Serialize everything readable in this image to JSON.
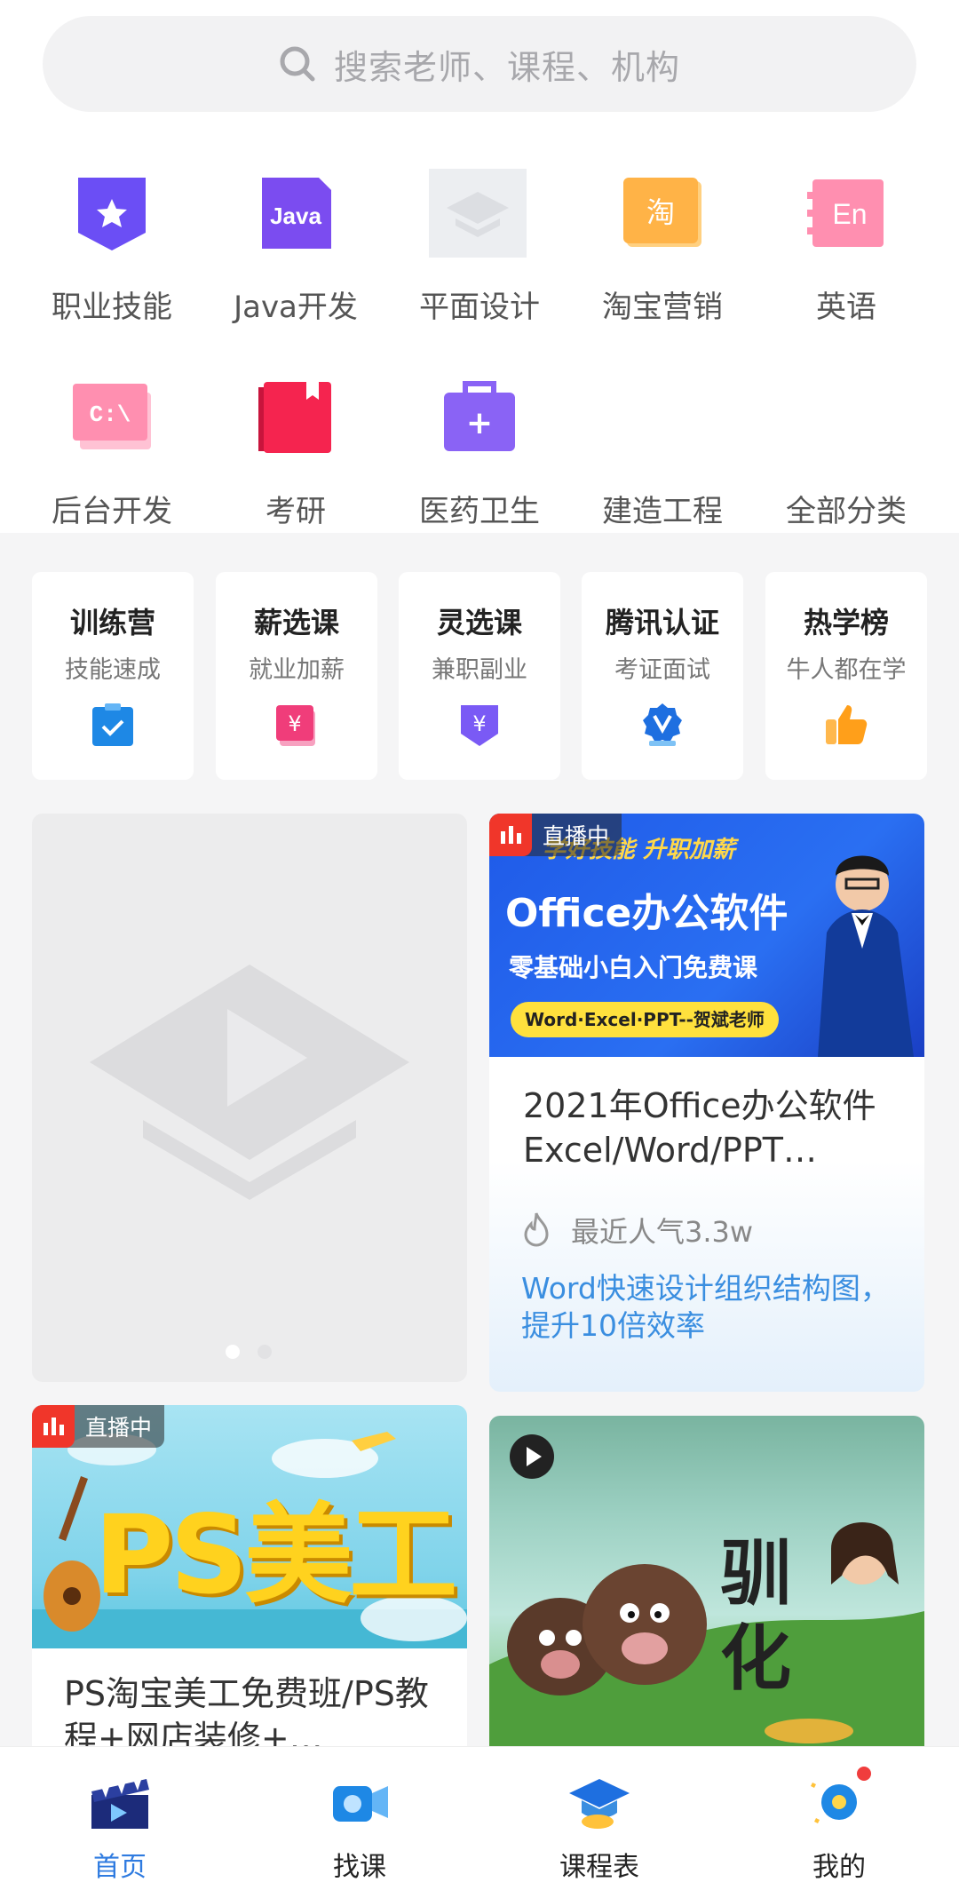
{
  "search": {
    "placeholder": "搜索老师、课程、机构",
    "icon": "search-icon"
  },
  "categories": [
    {
      "label": "职业技能",
      "icon": "badge-star-icon",
      "color": "#6b4ef5"
    },
    {
      "label": "Java开发",
      "icon": "java-file-icon",
      "color": "#7b4cf0",
      "text": "Java"
    },
    {
      "label": "平面设计",
      "icon": "placeholder-image-icon",
      "color": "#e6e7ea"
    },
    {
      "label": "淘宝营销",
      "icon": "taobao-icon",
      "color": "#ffb347",
      "text": "淘"
    },
    {
      "label": "英语",
      "icon": "english-book-icon",
      "color": "#ff7fa0",
      "text": "En"
    },
    {
      "label": "后台开发",
      "icon": "terminal-icon",
      "color": "#ff8fb0",
      "text": "C:\\"
    },
    {
      "label": "考研",
      "icon": "bookmark-book-icon",
      "color": "#f5244f"
    },
    {
      "label": "医药卫生",
      "icon": "medical-kit-icon",
      "color": "#8a63f5",
      "text": "+"
    },
    {
      "label": "建造工程",
      "icon": "",
      "color": ""
    },
    {
      "label": "全部分类",
      "icon": "",
      "color": ""
    }
  ],
  "features": [
    {
      "title": "训练营",
      "subtitle": "技能速成",
      "icon": "check-clipboard-icon",
      "color": "#1e88e5"
    },
    {
      "title": "薪选课",
      "subtitle": "就业加薪",
      "icon": "yen-card-icon",
      "color": "#f03d7a"
    },
    {
      "title": "灵选课",
      "subtitle": "兼职副业",
      "icon": "yen-shield-icon",
      "color": "#7a5af5"
    },
    {
      "title": "腾讯认证",
      "subtitle": "考证面试",
      "icon": "certificate-medal-icon",
      "color": "#1e6fe0"
    },
    {
      "title": "热学榜",
      "subtitle": "牛人都在学",
      "icon": "thumbs-up-icon",
      "color": "#ff9f1a"
    }
  ],
  "live_label": "直播中",
  "courses": {
    "office": {
      "banner_top": "学好技能  升职加薪",
      "banner_title": "Office办公软件",
      "banner_sub": "零基础小白入门免费课",
      "banner_tag": "Word·Excel·PPT--贺斌老师",
      "title": "2021年Office办公软件Excel/Word/PPT…",
      "popularity": "最近人气3.3w",
      "highlight": "Word快速设计组织结构图，提升10倍效率"
    },
    "ps": {
      "banner_text": "PS美工",
      "title": "PS淘宝美工免费班/PS教程+网店装修+…"
    },
    "train": {
      "banner_text": "驯化"
    }
  },
  "tabs": [
    {
      "label": "首页",
      "icon": "clapperboard-icon",
      "active": true
    },
    {
      "label": "找课",
      "icon": "camera-search-icon",
      "active": false
    },
    {
      "label": "课程表",
      "icon": "graduation-cap-icon",
      "active": false
    },
    {
      "label": "我的",
      "icon": "profile-gear-icon",
      "active": false
    }
  ],
  "colors": {
    "accent": "#2f7be0",
    "live_red": "#f0362a",
    "highlight_blue": "#3a8ee0"
  }
}
